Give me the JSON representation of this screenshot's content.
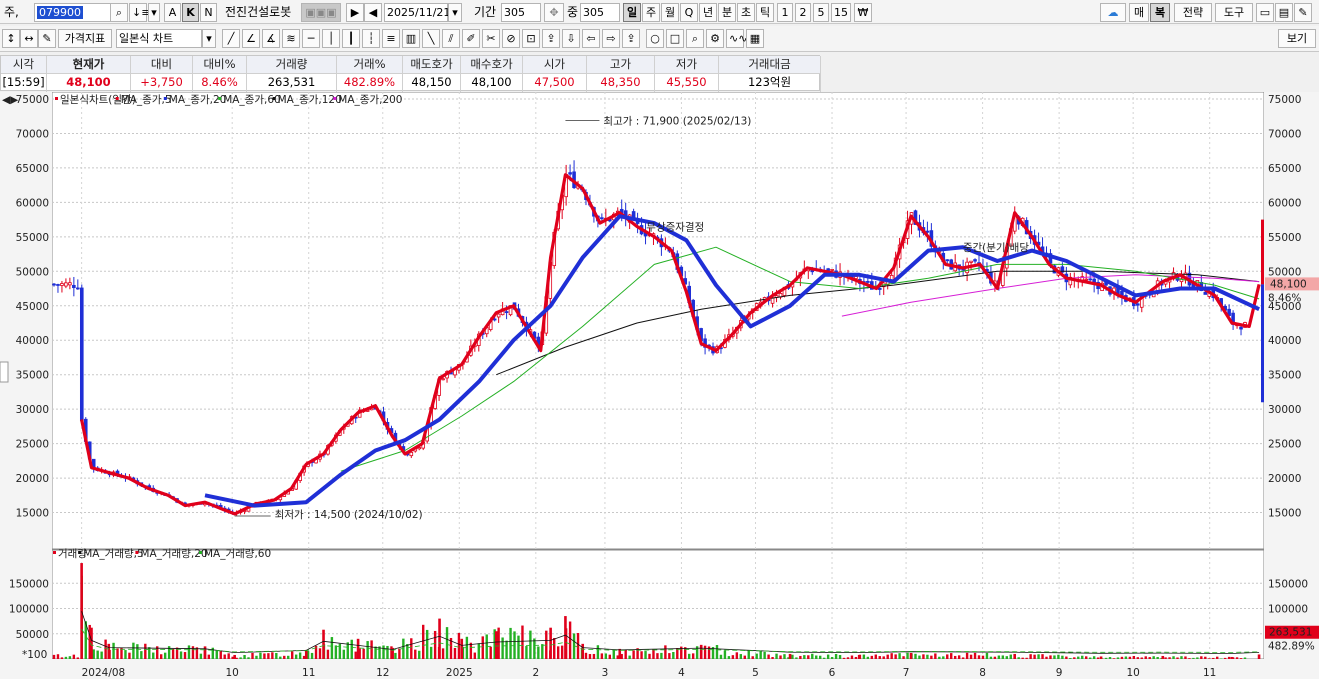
{
  "toolbar": {
    "market_label": "주,",
    "stock_code": "079900",
    "stock_name": "전진건설로봇",
    "date": "2025/11/21",
    "period_label": "기간",
    "period_value": "305",
    "zoom_label": "중",
    "zoom_value": "305",
    "interval_tabs": [
      "일",
      "주",
      "월",
      "Q",
      "년",
      "분",
      "초",
      "틱",
      "1",
      "2",
      "5",
      "15"
    ],
    "active_interval": "일",
    "mode_buttons": [
      "A",
      "K",
      "N"
    ],
    "active_mode": "K",
    "right_buttons": [
      "매",
      "복",
      "전략",
      "도구"
    ],
    "indicator_button": "가격지표",
    "chart_type": "일본식 차트",
    "view_button": "보기"
  },
  "quote": {
    "headers": [
      "시각",
      "현재가",
      "대비",
      "대비%",
      "거래량",
      "거래%",
      "매도호가",
      "매수호가",
      "시가",
      "고가",
      "저가",
      "거래대금"
    ],
    "values": [
      "[15:59]",
      "48,100",
      "+3,750",
      "8.46%",
      "263,531",
      "482.89%",
      "48,150",
      "48,100",
      "47,500",
      "48,350",
      "45,550",
      "123억원"
    ]
  },
  "chart_data": [
    {
      "type": "candlestick",
      "legend": [
        "일본식차트(일간)",
        "MA_종가,5",
        "MA_종가,20",
        "MA_종가,60",
        "MA_종가,120",
        "MA_종가,200"
      ],
      "legend_colors": [
        "#222222",
        "#e0001b",
        "#e0001b",
        "#1f2fd6",
        "#24b024",
        "#111111",
        "#d61fd6"
      ],
      "x_labels": [
        "2024/08",
        "10",
        "11",
        "12",
        "2025",
        "2",
        "3",
        "4",
        "5",
        "6",
        "7",
        "8",
        "9",
        "10",
        "11"
      ],
      "y_ticks": [
        15000,
        20000,
        25000,
        30000,
        35000,
        40000,
        45000,
        50000,
        55000,
        60000,
        65000,
        70000,
        75000
      ],
      "ylim": [
        10000,
        75000
      ],
      "highest_label": "최고가 : 71,900 (2025/02/13)",
      "lowest_label": "최저가 : 14,500 (2024/10/02)",
      "annotations": [
        "무상증자결정",
        "중간(분기)배당"
      ],
      "current_price": "48,100",
      "current_change": "8.46%",
      "close_points": [
        {
          "x": "2024/08/01",
          "y": 28500
        },
        {
          "x": "2024/08/05",
          "y": 21500
        },
        {
          "x": "2024/08/12",
          "y": 20800
        },
        {
          "x": "2024/08/20",
          "y": 20000
        },
        {
          "x": "2024/08/28",
          "y": 18500
        },
        {
          "x": "2024/09/05",
          "y": 17500
        },
        {
          "x": "2024/09/12",
          "y": 16000
        },
        {
          "x": "2024/09/20",
          "y": 16500
        },
        {
          "x": "2024/09/27",
          "y": 15500
        },
        {
          "x": "2024/10/02",
          "y": 14800
        },
        {
          "x": "2024/10/10",
          "y": 16200
        },
        {
          "x": "2024/10/18",
          "y": 16800
        },
        {
          "x": "2024/10/25",
          "y": 18500
        },
        {
          "x": "2024/10/31",
          "y": 22000
        },
        {
          "x": "2024/11/07",
          "y": 23500
        },
        {
          "x": "2024/11/14",
          "y": 27000
        },
        {
          "x": "2024/11/21",
          "y": 29500
        },
        {
          "x": "2024/11/28",
          "y": 30500
        },
        {
          "x": "2024/12/05",
          "y": 26000
        },
        {
          "x": "2024/12/10",
          "y": 23500
        },
        {
          "x": "2024/12/17",
          "y": 25000
        },
        {
          "x": "2024/12/24",
          "y": 34500
        },
        {
          "x": "2025/01/02",
          "y": 36500
        },
        {
          "x": "2025/01/09",
          "y": 40500
        },
        {
          "x": "2025/01/16",
          "y": 44000
        },
        {
          "x": "2025/01/23",
          "y": 45000
        },
        {
          "x": "2025/02/03",
          "y": 38500
        },
        {
          "x": "2025/02/07",
          "y": 52000
        },
        {
          "x": "2025/02/13",
          "y": 64000
        },
        {
          "x": "2025/02/20",
          "y": 62000
        },
        {
          "x": "2025/02/27",
          "y": 57000
        },
        {
          "x": "2025/03/07",
          "y": 58500
        },
        {
          "x": "2025/03/14",
          "y": 56500
        },
        {
          "x": "2025/03/21",
          "y": 55000
        },
        {
          "x": "2025/03/28",
          "y": 53000
        },
        {
          "x": "2025/04/03",
          "y": 47000
        },
        {
          "x": "2025/04/09",
          "y": 39500
        },
        {
          "x": "2025/04/15",
          "y": 38500
        },
        {
          "x": "2025/04/22",
          "y": 41000
        },
        {
          "x": "2025/04/29",
          "y": 44000
        },
        {
          "x": "2025/05/08",
          "y": 46500
        },
        {
          "x": "2025/05/15",
          "y": 48000
        },
        {
          "x": "2025/05/22",
          "y": 50500
        },
        {
          "x": "2025/05/29",
          "y": 50000
        },
        {
          "x": "2025/06/05",
          "y": 49500
        },
        {
          "x": "2025/06/12",
          "y": 48500
        },
        {
          "x": "2025/06/19",
          "y": 47500
        },
        {
          "x": "2025/06/26",
          "y": 50500
        },
        {
          "x": "2025/07/03",
          "y": 58000
        },
        {
          "x": "2025/07/10",
          "y": 55000
        },
        {
          "x": "2025/07/17",
          "y": 51000
        },
        {
          "x": "2025/07/24",
          "y": 50500
        },
        {
          "x": "2025/07/31",
          "y": 51000
        },
        {
          "x": "2025/08/07",
          "y": 47500
        },
        {
          "x": "2025/08/14",
          "y": 58500
        },
        {
          "x": "2025/08/21",
          "y": 55000
        },
        {
          "x": "2025/08/28",
          "y": 51000
        },
        {
          "x": "2025/09/04",
          "y": 49000
        },
        {
          "x": "2025/09/11",
          "y": 48500
        },
        {
          "x": "2025/09/18",
          "y": 48000
        },
        {
          "x": "2025/09/25",
          "y": 46500
        },
        {
          "x": "2025/10/02",
          "y": 45500
        },
        {
          "x": "2025/10/13",
          "y": 48500
        },
        {
          "x": "2025/10/20",
          "y": 49500
        },
        {
          "x": "2025/10/27",
          "y": 48000
        },
        {
          "x": "2025/11/03",
          "y": 46500
        },
        {
          "x": "2025/11/10",
          "y": 42500
        },
        {
          "x": "2025/11/17",
          "y": 42000
        },
        {
          "x": "2025/11/21",
          "y": 48100
        }
      ],
      "ma60_points": [
        {
          "x": "2024/09/20",
          "y": 17500
        },
        {
          "x": "2024/10/10",
          "y": 16000
        },
        {
          "x": "2024/10/31",
          "y": 16500
        },
        {
          "x": "2024/11/14",
          "y": 20500
        },
        {
          "x": "2024/11/28",
          "y": 24000
        },
        {
          "x": "2024/12/10",
          "y": 25500
        },
        {
          "x": "2024/12/24",
          "y": 28500
        },
        {
          "x": "2025/01/09",
          "y": 34000
        },
        {
          "x": "2025/01/23",
          "y": 40000
        },
        {
          "x": "2025/02/07",
          "y": 45000
        },
        {
          "x": "2025/02/20",
          "y": 52000
        },
        {
          "x": "2025/03/07",
          "y": 58000
        },
        {
          "x": "2025/03/21",
          "y": 57000
        },
        {
          "x": "2025/04/03",
          "y": 54500
        },
        {
          "x": "2025/04/15",
          "y": 48000
        },
        {
          "x": "2025/04/29",
          "y": 42000
        },
        {
          "x": "2025/05/15",
          "y": 45000
        },
        {
          "x": "2025/05/29",
          "y": 49500
        },
        {
          "x": "2025/06/12",
          "y": 49500
        },
        {
          "x": "2025/06/26",
          "y": 48500
        },
        {
          "x": "2025/07/10",
          "y": 53000
        },
        {
          "x": "2025/07/24",
          "y": 53500
        },
        {
          "x": "2025/08/07",
          "y": 51500
        },
        {
          "x": "2025/08/21",
          "y": 53000
        },
        {
          "x": "2025/09/04",
          "y": 51500
        },
        {
          "x": "2025/09/18",
          "y": 49000
        },
        {
          "x": "2025/10/02",
          "y": 46500
        },
        {
          "x": "2025/10/20",
          "y": 47500
        },
        {
          "x": "2025/11/03",
          "y": 47500
        },
        {
          "x": "2025/11/21",
          "y": 44500
        }
      ],
      "ma120_points": [
        {
          "x": "2024/11/14",
          "y": 21000
        },
        {
          "x": "2024/12/10",
          "y": 24000
        },
        {
          "x": "2025/01/02",
          "y": 29000
        },
        {
          "x": "2025/01/23",
          "y": 34000
        },
        {
          "x": "2025/02/20",
          "y": 42000
        },
        {
          "x": "2025/03/21",
          "y": 51000
        },
        {
          "x": "2025/04/15",
          "y": 53500
        },
        {
          "x": "2025/05/15",
          "y": 48500
        },
        {
          "x": "2025/06/12",
          "y": 47500
        },
        {
          "x": "2025/07/10",
          "y": 49000
        },
        {
          "x": "2025/08/07",
          "y": 51000
        },
        {
          "x": "2025/09/04",
          "y": 51000
        },
        {
          "x": "2025/10/02",
          "y": 50000
        },
        {
          "x": "2025/11/03",
          "y": 48000
        },
        {
          "x": "2025/11/21",
          "y": 46000
        }
      ],
      "ma200_points": [
        {
          "x": "2025/01/16",
          "y": 35000
        },
        {
          "x": "2025/02/13",
          "y": 39000
        },
        {
          "x": "2025/03/14",
          "y": 42500
        },
        {
          "x": "2025/04/09",
          "y": 44500
        },
        {
          "x": "2025/05/15",
          "y": 46500
        },
        {
          "x": "2025/06/26",
          "y": 48000
        },
        {
          "x": "2025/08/07",
          "y": 50000
        },
        {
          "x": "2025/09/18",
          "y": 50000
        },
        {
          "x": "2025/10/27",
          "y": 49500
        },
        {
          "x": "2025/11/21",
          "y": 48500
        }
      ],
      "ma_magenta_points": [
        {
          "x": "2025/06/05",
          "y": 43500
        },
        {
          "x": "2025/07/03",
          "y": 45500
        },
        {
          "x": "2025/08/07",
          "y": 47500
        },
        {
          "x": "2025/09/04",
          "y": 49000
        },
        {
          "x": "2025/10/02",
          "y": 49500
        },
        {
          "x": "2025/11/03",
          "y": 49000
        },
        {
          "x": "2025/11/21",
          "y": 48500
        }
      ]
    },
    {
      "type": "bar",
      "legend": [
        "거래량",
        "MA_거래량,5",
        "MA_거래량,20",
        "MA_거래량,60"
      ],
      "legend_colors": [
        "#222222",
        "#e0001b",
        "#111111",
        "#e0001b",
        "#24b024"
      ],
      "y_ticks": [
        50000,
        100000,
        150000
      ],
      "ylim": [
        0,
        200000
      ],
      "unit": "*100",
      "current_volume": "263,531",
      "current_volume_pct": "482.89%",
      "volume_points": [
        {
          "x": "2024/08/01",
          "y": 190000
        },
        {
          "x": "2024/08/05",
          "y": 62000
        },
        {
          "x": "2024/08/12",
          "y": 30000
        },
        {
          "x": "2024/09/20",
          "y": 25000
        },
        {
          "x": "2024/10/02",
          "y": 8000
        },
        {
          "x": "2024/10/31",
          "y": 18000
        },
        {
          "x": "2024/11/07",
          "y": 58000
        },
        {
          "x": "2024/11/21",
          "y": 40000
        },
        {
          "x": "2024/12/05",
          "y": 22000
        },
        {
          "x": "2024/12/24",
          "y": 80000
        },
        {
          "x": "2025/01/02",
          "y": 40000
        },
        {
          "x": "2025/01/16",
          "y": 55000
        },
        {
          "x": "2025/02/07",
          "y": 62000
        },
        {
          "x": "2025/02/13",
          "y": 85000
        },
        {
          "x": "2025/02/20",
          "y": 30000
        },
        {
          "x": "2025/03/07",
          "y": 20000
        },
        {
          "x": "2025/04/09",
          "y": 28000
        },
        {
          "x": "2025/05/15",
          "y": 10000
        },
        {
          "x": "2025/06/12",
          "y": 8000
        },
        {
          "x": "2025/07/03",
          "y": 12000
        },
        {
          "x": "2025/08/14",
          "y": 10000
        },
        {
          "x": "2025/09/18",
          "y": 5000
        },
        {
          "x": "2025/10/13",
          "y": 6000
        },
        {
          "x": "2025/11/10",
          "y": 4000
        },
        {
          "x": "2025/11/21",
          "y": 9000
        }
      ]
    }
  ]
}
